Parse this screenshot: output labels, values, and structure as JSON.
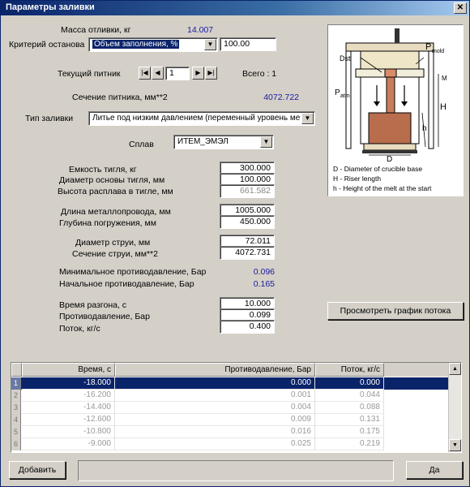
{
  "window": {
    "title": "Параметры заливки",
    "close_glyph": "✕"
  },
  "form": {
    "metal_mass": {
      "label": "Масса отливки, кг",
      "value": "14.007"
    },
    "stop_criterion": {
      "label": "Критерий останова",
      "selected": "Объем заполнения, %",
      "value": "100.00"
    },
    "current_feeder": {
      "label": "Текущий питник",
      "value": "1",
      "total": "Всего : 1"
    },
    "feeder_section": {
      "label": "Сечение питника, мм**2",
      "value": "4072.722"
    },
    "casting_type": {
      "label": "Тип заливки",
      "selected": "Литье под низким давлением (переменный уровень ме"
    },
    "alloy": {
      "label": "Сплав",
      "selected": "ИТЕМ_ЭМЭЛ"
    },
    "crucible_capacity": {
      "label": "Емкость тигля, кг",
      "value": "300.000"
    },
    "crucible_diameter": {
      "label": "Диаметр основы тигля, мм",
      "value": "100.000"
    },
    "melt_height": {
      "label": "Высота расплава в тигле, мм",
      "value": "661.582"
    },
    "pipe_length": {
      "label": "Длина металлопровода, мм",
      "value": "1005.000"
    },
    "immersion_depth": {
      "label": "Глубина погружения, мм",
      "value": "450.000"
    },
    "jet_diameter": {
      "label": "Диаметр струи, мм",
      "value": "72.011"
    },
    "jet_section": {
      "label": "Сечение струи, мм**2",
      "value": "4072.731"
    },
    "min_backpressure": {
      "label": "Минимальное противодавление, Бар",
      "value": "0.096"
    },
    "start_backpressure": {
      "label": "Начальное противодавление, Бар",
      "value": "0.165"
    },
    "accel_time": {
      "label": "Время разгона, с",
      "value": "10.000"
    },
    "backpressure": {
      "label": "Противодавление, Бар",
      "value": "0.099"
    },
    "flow": {
      "label": "Поток, кг/с",
      "value": "0.400"
    }
  },
  "buttons": {
    "view_graph": "Просмотреть график потока",
    "add": "Добавить",
    "ok": "Да"
  },
  "diagram": {
    "labels": {
      "p_mold": "P",
      "p_mold_sub": "mold",
      "d_st": "Dst",
      "p_atm": "P",
      "p_atm_sub": "atm",
      "h": "h",
      "h_big": "H",
      "d": "D",
      "ml": "M"
    },
    "legend": [
      "D - Diameter of crucible base",
      "H - Riser length",
      "h - Height of the melt at the start"
    ]
  },
  "table": {
    "headers": [
      "Время, с",
      "Противодавление, Бар",
      "Поток, кг/с"
    ],
    "rows": [
      {
        "n": "1",
        "time": "-18.000",
        "backpressure": "0.000",
        "flow": "0.000"
      },
      {
        "n": "2",
        "time": "-16.200",
        "backpressure": "0.001",
        "flow": "0.044"
      },
      {
        "n": "3",
        "time": "-14.400",
        "backpressure": "0.004",
        "flow": "0.088"
      },
      {
        "n": "4",
        "time": "-12.600",
        "backpressure": "0.009",
        "flow": "0.131"
      },
      {
        "n": "5",
        "time": "-10.800",
        "backpressure": "0.016",
        "flow": "0.175"
      },
      {
        "n": "6",
        "time": "-9.000",
        "backpressure": "0.025",
        "flow": "0.219"
      }
    ]
  }
}
